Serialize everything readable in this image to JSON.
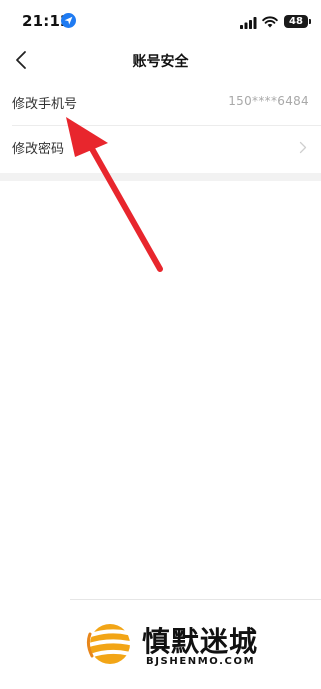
{
  "status_bar": {
    "time": "21:12",
    "battery_level": "48",
    "icons": [
      "location-arrow-icon",
      "cellular-signal-icon",
      "wifi-icon",
      "battery-icon"
    ]
  },
  "nav": {
    "title": "账号安全",
    "back_icon": "chevron-left-icon"
  },
  "settings": {
    "rows": [
      {
        "label": "修改手机号",
        "value": "150****6484"
      },
      {
        "label": "修改密码",
        "icon": "chevron-right-icon"
      }
    ]
  },
  "annotation": {
    "arrow_color": "#e8262d"
  },
  "watermark": {
    "title": "慎默迷城",
    "subtitle": "BJSHENMO.COM",
    "colors": {
      "gold": "#f2a516",
      "orange": "#e8861a"
    }
  }
}
